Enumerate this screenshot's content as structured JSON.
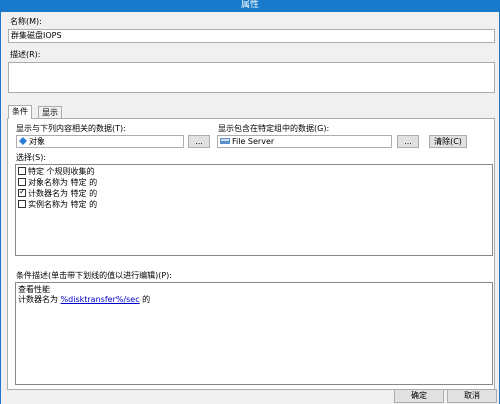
{
  "window": {
    "title": "属性"
  },
  "name": {
    "label": "名称(M):",
    "value": "群集磁盘IOPS"
  },
  "description": {
    "label": "描述(R):",
    "value": ""
  },
  "tabs": [
    {
      "label": "条件"
    },
    {
      "label": "显示"
    }
  ],
  "objects": {
    "label": "显示与下列内容相关的数据(T):",
    "value": "对象",
    "browse_label": "..."
  },
  "groups": {
    "label": "显示包含在特定组中的数据(G):",
    "value": "File Server",
    "browse_label": "...",
    "clear_label": "清除(C)"
  },
  "selection": {
    "label": "选择(S):",
    "items": [
      {
        "label": "特定 个规则收集的",
        "checked": false
      },
      {
        "label": "对象名称为 特定 的",
        "checked": false
      },
      {
        "label": "计数器名为 特定 的",
        "checked": true
      },
      {
        "label": "实例名称为 特定 的",
        "checked": false
      }
    ]
  },
  "criteria": {
    "label": "条件描述(单击带下划线的值以进行编辑)(P):",
    "line1": "查看性能",
    "line2_prefix": "计数器名为 ",
    "line2_link": "%disktransfer%/sec",
    "line2_suffix": " 的"
  },
  "footer": {
    "ok_label": "确定",
    "cancel_label": "取消"
  }
}
